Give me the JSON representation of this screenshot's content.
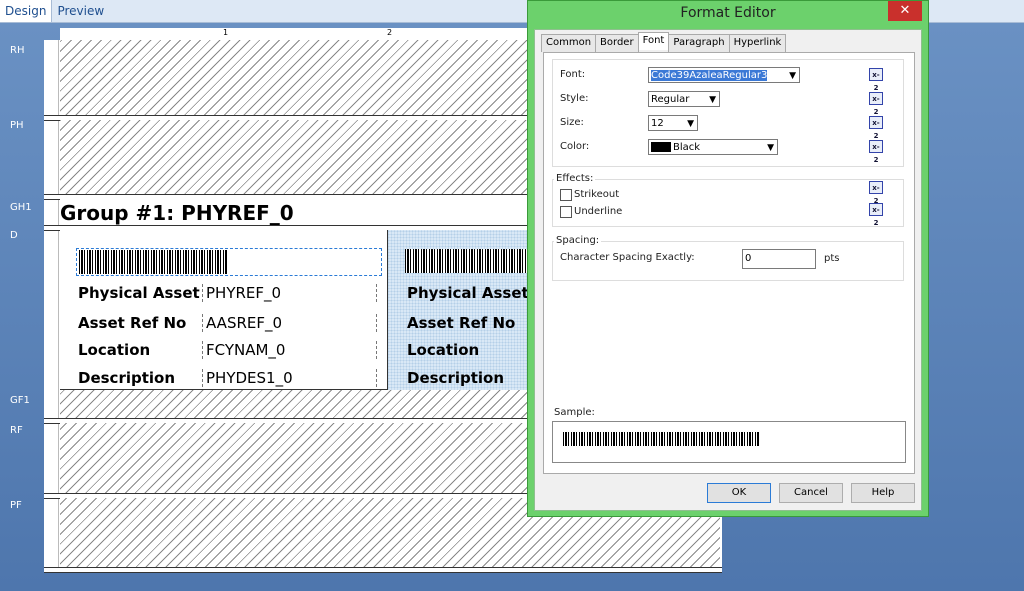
{
  "designer": {
    "tabs": [
      "Design",
      "Preview"
    ],
    "ruler_marks": [
      "1",
      "2"
    ],
    "bands": [
      "RH",
      "PH",
      "GH1",
      "D",
      "GF1",
      "RF",
      "PF"
    ],
    "group_header": "Group #1: PHYREF_0",
    "detail": {
      "labels": [
        "Physical Asset",
        "Asset Ref No",
        "Location",
        "Description"
      ],
      "fields": [
        "PHYREF_0",
        "AASREF_0",
        "FCYNAM_0",
        "PHYDES1_0"
      ]
    }
  },
  "dialog": {
    "title": "Format Editor",
    "close": "✕",
    "tabs": [
      "Common",
      "Border",
      "Font",
      "Paragraph",
      "Hyperlink"
    ],
    "active_tab": "Font",
    "font_label": "Font:",
    "font_value": "Code39AzaleaRegular3",
    "style_label": "Style:",
    "style_value": "Regular",
    "size_label": "Size:",
    "size_value": "12",
    "color_label": "Color:",
    "color_value": "Black",
    "effects_title": "Effects:",
    "strikeout": "Strikeout",
    "underline": "Underline",
    "spacing_title": "Spacing:",
    "char_spacing_label": "Character Spacing Exactly:",
    "char_spacing_value": "0",
    "char_spacing_unit": "pts",
    "sample_label": "Sample:",
    "formula_icon": "x-2",
    "ok": "OK",
    "cancel": "Cancel",
    "help": "Help"
  }
}
